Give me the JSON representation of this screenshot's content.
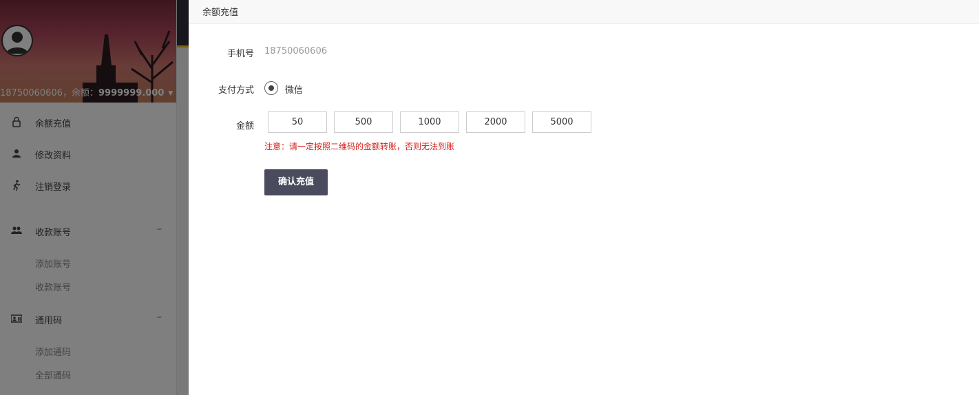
{
  "sidebar": {
    "user_phone": "18750060606",
    "balance_prefix": "，余额：",
    "balance_value": "9999999.000",
    "items": [
      {
        "label": "余额充值",
        "icon": "lock-icon"
      },
      {
        "label": "修改资料",
        "icon": "user-icon"
      },
      {
        "label": "注销登录",
        "icon": "walking-icon"
      }
    ],
    "groups": [
      {
        "label": "收款账号",
        "icon": "group-icon",
        "toggle": "–",
        "subitems": [
          "添加账号",
          "收款账号"
        ]
      },
      {
        "label": "通用码",
        "icon": "id-card-icon",
        "toggle": "–",
        "subitems": [
          "添加通码",
          "全部通码"
        ]
      }
    ]
  },
  "panel": {
    "title": "余额充值",
    "phone_label": "手机号",
    "phone_value": "18750060606",
    "payment_label": "支付方式",
    "payment_option": "微信",
    "amount_label": "金额",
    "amounts": [
      "50",
      "500",
      "1000",
      "2000",
      "5000"
    ],
    "notice": "注意：请一定按照二维码的金额转账，否则无法到账",
    "submit_label": "确认充值"
  },
  "colors": {
    "notice": "#d0211b",
    "submit_bg": "#4a4c5e",
    "topbar_accent": "#f0c020"
  }
}
